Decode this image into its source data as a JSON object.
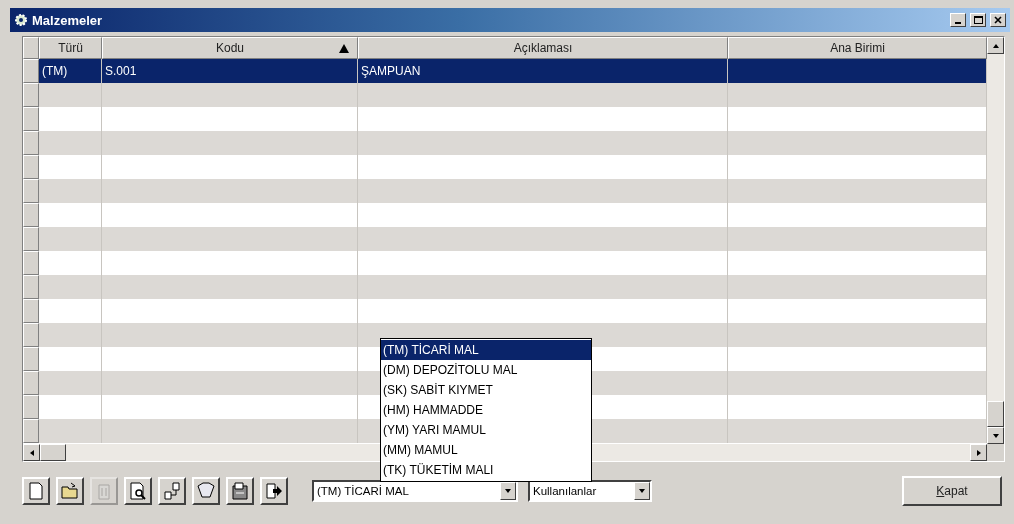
{
  "window": {
    "title": "Malzemeler"
  },
  "table": {
    "columns": [
      {
        "label": "Türü",
        "sorted": false
      },
      {
        "label": "Kodu",
        "sorted": true
      },
      {
        "label": "Açıklaması",
        "sorted": false
      },
      {
        "label": "Ana Birimi",
        "sorted": false
      }
    ],
    "rows": [
      {
        "cells": [
          "(TM)",
          "S.001",
          "ŞAMPUAN"
        ],
        "selected": true
      }
    ]
  },
  "type_list": {
    "items": [
      {
        "label": "(TM) TİCARİ MAL",
        "selected": true
      },
      {
        "label": "(DM) DEPOZİTOLU MAL",
        "selected": false
      },
      {
        "label": "(SK) SABİT KIYMET",
        "selected": false
      },
      {
        "label": "(HM) HAMMADDE",
        "selected": false
      },
      {
        "label": "(YM) YARI MAMUL",
        "selected": false
      },
      {
        "label": "(MM) MAMUL",
        "selected": false
      },
      {
        "label": "(TK) TÜKETİM MALI",
        "selected": false
      }
    ]
  },
  "toolbar": [
    {
      "kind": "new",
      "disabled": false
    },
    {
      "kind": "open",
      "disabled": false
    },
    {
      "kind": "delete",
      "disabled": true
    },
    {
      "kind": "preview",
      "disabled": false
    },
    {
      "kind": "link",
      "disabled": false
    },
    {
      "kind": "filter",
      "disabled": false
    },
    {
      "kind": "archive",
      "disabled": false
    },
    {
      "kind": "export",
      "disabled": false
    }
  ],
  "type_combo": {
    "value": "(TM) TİCARİ MAL"
  },
  "user_combo": {
    "value": "Kullanılanlar"
  },
  "close_button": {
    "label": "Kapat"
  }
}
